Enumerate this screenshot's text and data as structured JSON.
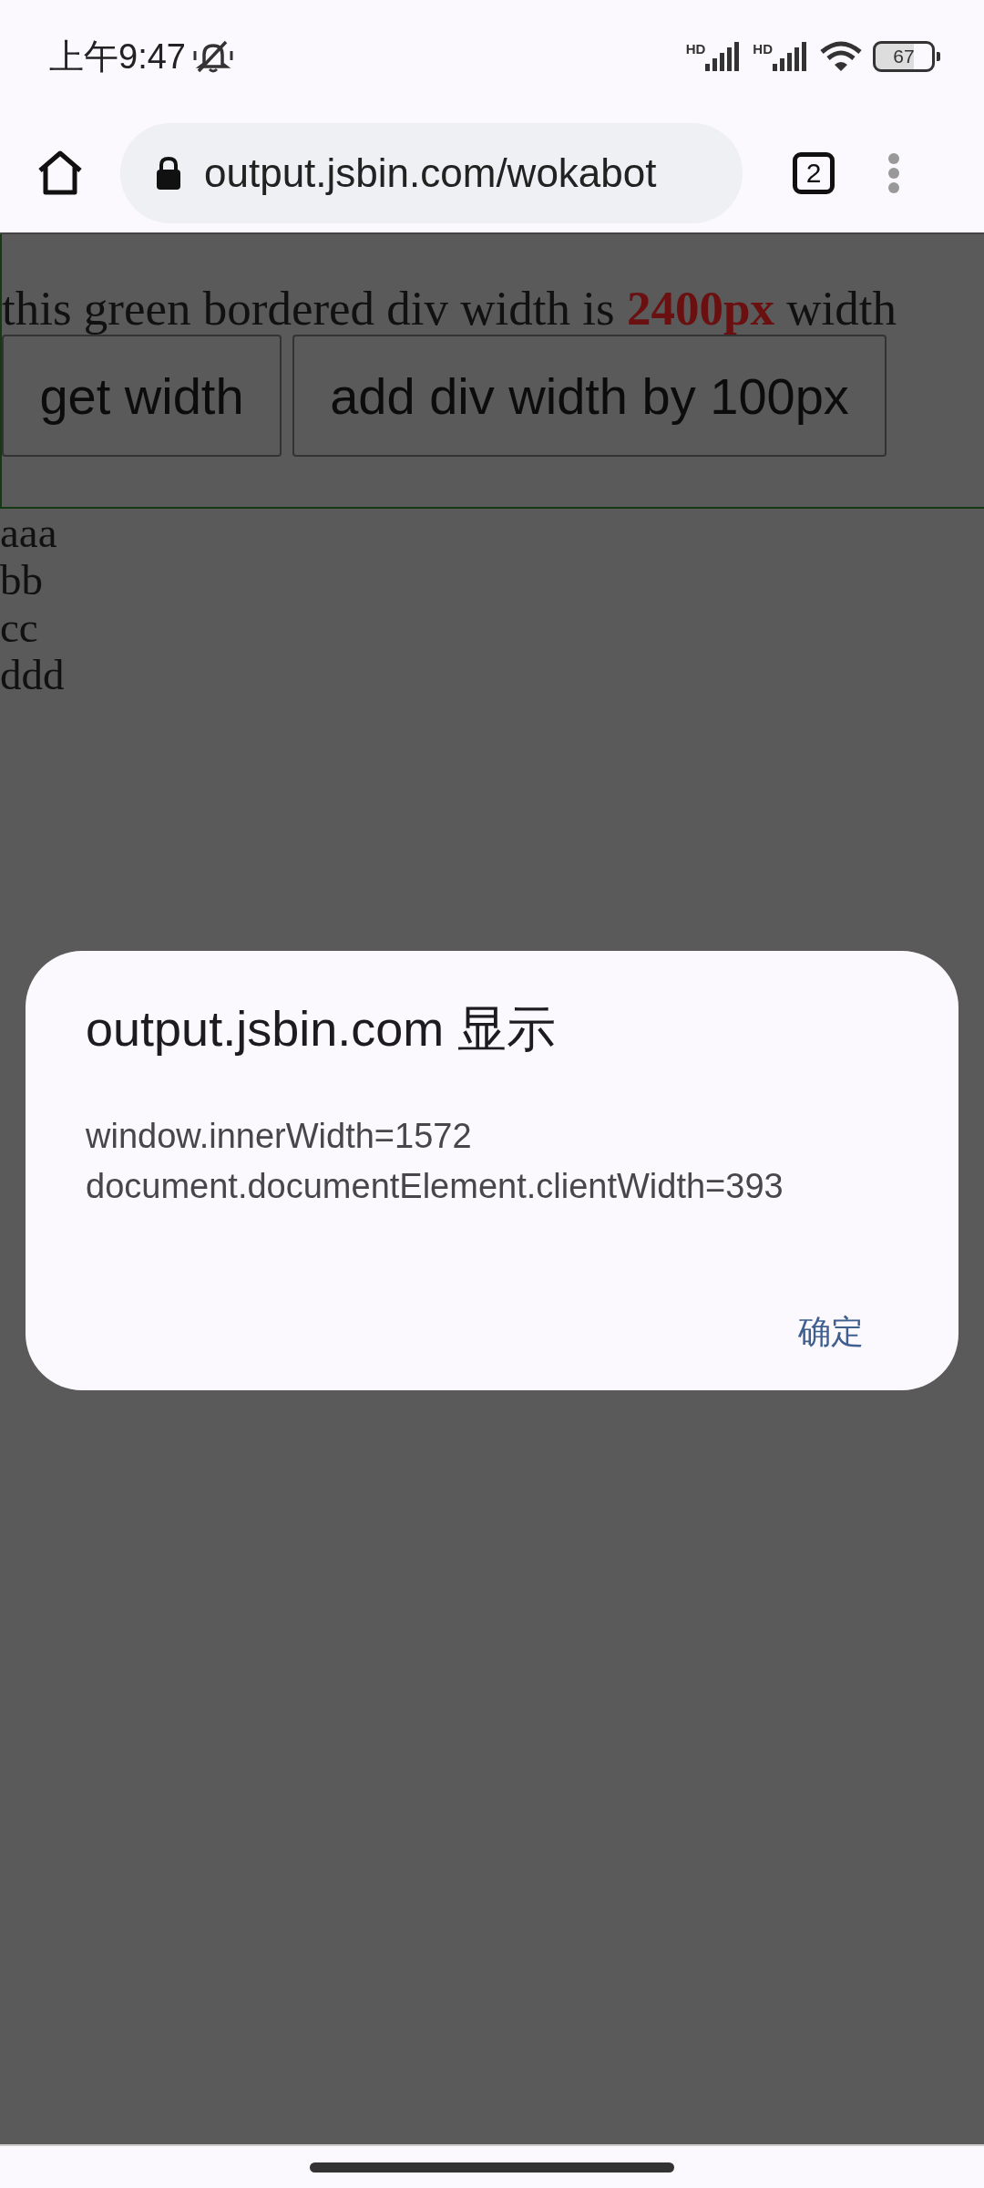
{
  "status_bar": {
    "time": "上午9:47",
    "muted": true,
    "signals": [
      {
        "label": "HD"
      },
      {
        "label": "HD"
      }
    ],
    "battery": "67"
  },
  "browser": {
    "url": "output.jsbin.com/wokabot",
    "tab_count": "2"
  },
  "page": {
    "paragraph": "this green bordered div width is **2400px** width",
    "buttons": [
      "get width",
      "add div width by 100px"
    ],
    "lines": [
      "aaa",
      "bb",
      "cc",
      "ddd"
    ]
  },
  "dialog": {
    "title": "output.jsbin.com 显示",
    "message": [
      "window.innerWidth=1572",
      "document.documentElement.clientWidth=393"
    ],
    "button": "确定"
  }
}
